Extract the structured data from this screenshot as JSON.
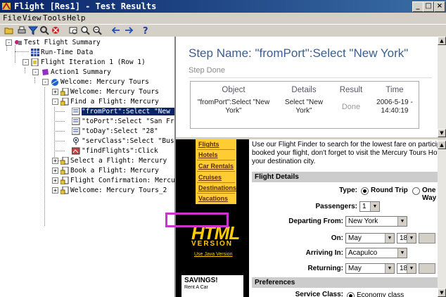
{
  "window": {
    "title": "Flight [Res1] - Test Results"
  },
  "menu": [
    "File",
    "View",
    "Tools",
    "Help"
  ],
  "tree": {
    "items": [
      "Test Flight Summary",
      "Run-Time Data",
      "Flight Iteration 1 (Row 1)",
      "Action1 Summary",
      "Welcome: Mercury Tours",
      "Welcome: Mercury Tours",
      "Find a Flight: Mercury",
      "\"fromPort\":Select \"New York",
      "\"toPort\":Select \"San Franci",
      "\"toDay\":Select \"28\"",
      "\"servClass\":Select \"Busines",
      "\"findFlights\":Click",
      "Select a Flight: Mercury",
      "Book a Flight: Mercury",
      "Flight Confirmation: Mercury",
      "Welcome: Mercury Tours_2"
    ]
  },
  "step": {
    "title": "Step Name: \"fromPort\":Select \"New York\"",
    "status": "Step Done",
    "headers": [
      "Object",
      "Details",
      "Result",
      "Time"
    ],
    "row": {
      "object_l1": "\"fromPort\":Select \"New",
      "object_l2": "York\"",
      "details_l1": "Select \"New",
      "details_l2": "York\"",
      "result": "Done",
      "time_l1": "2006-5-19 -",
      "time_l2": "14:40:19"
    }
  },
  "webpage": {
    "nav": [
      "Flights",
      "Hotels",
      "Car Rentals",
      "Cruises",
      "Destinations",
      "Vacations"
    ],
    "logo": "HTML",
    "version": "VERSION",
    "java_link": "Use Java Version",
    "ad_title": "SAVINGS!",
    "ad_sub": "Rent A Car",
    "intro_l1": "Use our Flight Finder to search for the lowest fare on participa",
    "intro_l2": "booked your flight, don't forget to visit the Mercury Tours Hotel",
    "intro_l3": "your destination city.",
    "flight_details": "Flight Details",
    "type_label": "Type:",
    "round_trip": "Round Trip",
    "one_way": "One Way",
    "passengers_label": "Passengers:",
    "passengers_value": "1",
    "departing_label": "Departing From:",
    "departing_value": "New York",
    "on_label": "On:",
    "on_month": "May",
    "on_day": "18",
    "arriving_label": "Arriving In:",
    "arriving_value": "Acapulco",
    "returning_label": "Returning:",
    "ret_month": "May",
    "ret_day": "18",
    "preferences": "Preferences",
    "service_label": "Service Class:",
    "service_value": "Economy class"
  }
}
